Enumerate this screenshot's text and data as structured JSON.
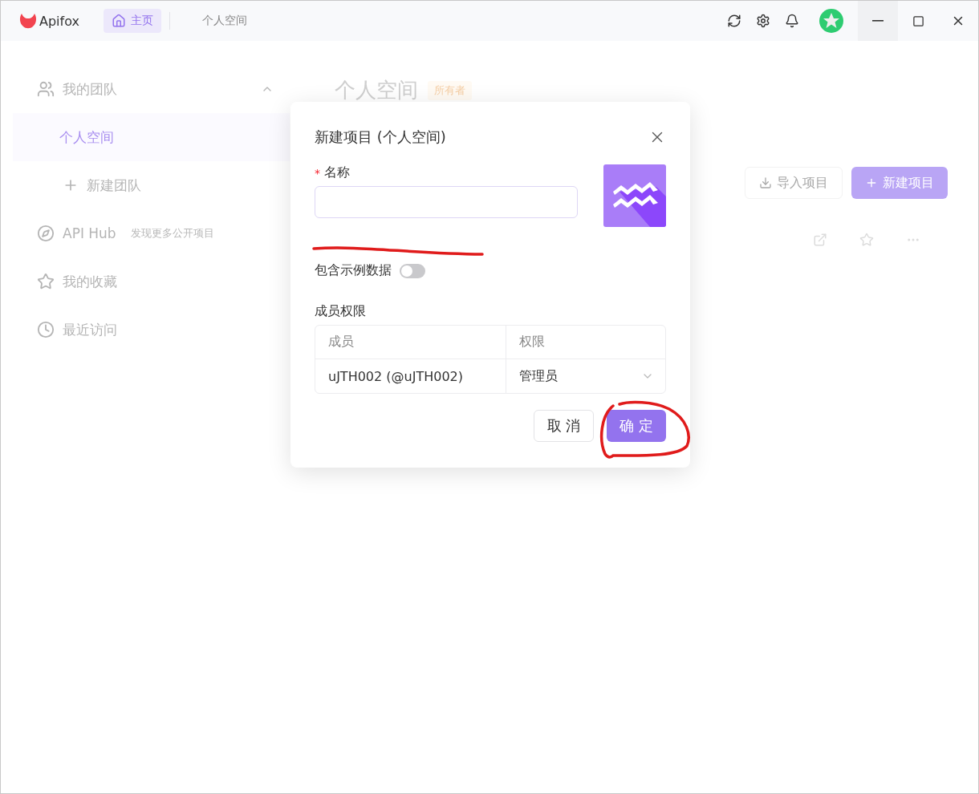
{
  "titlebar": {
    "app_name": "Apifox",
    "tabs": [
      {
        "label": "主页",
        "selected": true
      },
      {
        "label": "个人空间",
        "selected": false
      }
    ]
  },
  "sidebar": {
    "team": {
      "label": "我的团队",
      "expanded": true,
      "items": [
        {
          "label": "个人空间",
          "selected": true
        }
      ],
      "add_label": "新建团队"
    },
    "links": [
      {
        "kind": "hub",
        "label": "API Hub",
        "hint": "发现更多公开项目"
      },
      {
        "kind": "favorites",
        "label": "我的收藏"
      },
      {
        "kind": "recent",
        "label": "最近访问"
      }
    ]
  },
  "main": {
    "title": "个人空间",
    "badge": "所有者",
    "import_button": "导入项目",
    "new_button": "新建项目"
  },
  "dialog": {
    "title": "新建项目 (个人空间)",
    "name_label": "名称",
    "required_mark": "*",
    "include_sample": {
      "label": "包含示例数据",
      "on": false
    },
    "members": {
      "label": "成员权限",
      "columns": [
        "成员",
        "权限"
      ],
      "rows": [
        {
          "member": "uJTH002 (@uJTH002)",
          "role": "管理员"
        }
      ]
    },
    "cancel": "取 消",
    "ok": "确 定"
  }
}
